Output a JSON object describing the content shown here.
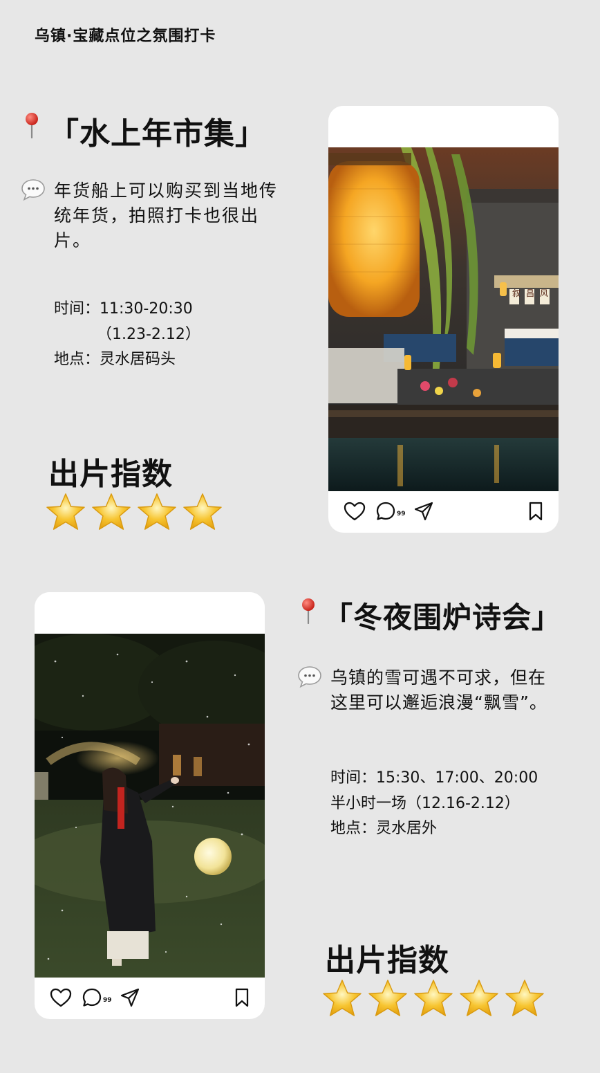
{
  "header": {
    "title": "乌镇·宝藏点位之氛围打卡"
  },
  "spots": [
    {
      "title": "「水上年市集」",
      "description": [
        "年货船上可以购买到当地传",
        "统年货，拍照打卡也很出",
        "片。"
      ],
      "info": [
        "时间：11:30-20:30",
        "（1.23-2.12）",
        "地点：灵水居码头"
      ],
      "rating_label": "出片指数",
      "rating": 4,
      "post": {
        "comment_count": "99",
        "photo_signs": [
          "叙",
          "昌",
          "风"
        ]
      }
    },
    {
      "title": "「冬夜围炉诗会」",
      "description": [
        "乌镇的雪可遇不可求，但在",
        "这里可以邂逅浪漫“飘雪”。"
      ],
      "info": [
        "时间：15:30、17:00、20:00",
        "半小时一场（12.16-2.12）",
        "地点：灵水居外"
      ],
      "rating_label": "出片指数",
      "rating": 5,
      "post": {
        "comment_count": "99"
      }
    }
  ],
  "icons": [
    "pin-icon",
    "speech-bubble-icon",
    "star-icon",
    "heart-icon",
    "comment-icon",
    "send-icon",
    "bookmark-icon"
  ],
  "colors": {
    "background": "#e7e7e7",
    "star": "#f7c531",
    "pin": "#e03a2f",
    "lantern": "#f5a623"
  }
}
